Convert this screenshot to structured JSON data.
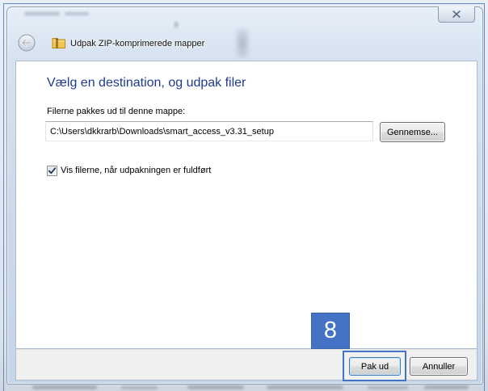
{
  "window": {
    "title": "Udpak ZIP-komprimerede mapper",
    "icons": {
      "back": "back-arrow-icon",
      "title": "zip-folder-icon",
      "close": "close-icon"
    }
  },
  "content": {
    "heading": "Vælg en destination, og udpak filer",
    "destination_label": "Filerne pakkes ud til denne mappe:",
    "destination_value": "C:\\Users\\dkkrarb\\Downloads\\smart_access_v3.31_setup",
    "browse_button": "Gennemse...",
    "show_files_checkbox": {
      "label": "Vis filerne, når udpakningen er fuldført",
      "checked": true,
      "icon": "checkmark-icon"
    }
  },
  "footer": {
    "extract_button": "Pak ud",
    "cancel_button": "Annuller"
  },
  "annotation": {
    "step_number": "8"
  },
  "colors": {
    "heading": "#1e3b8f",
    "annotation": "#4472c4"
  }
}
